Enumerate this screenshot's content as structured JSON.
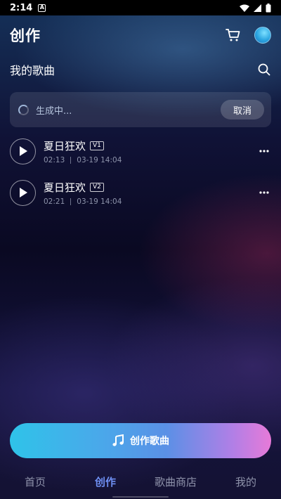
{
  "status_bar": {
    "time": "2:14",
    "notification_glyph": "A"
  },
  "header": {
    "title": "创作"
  },
  "section": {
    "label": "我的歌曲"
  },
  "generating": {
    "text": "生成中...",
    "cancel_label": "取消"
  },
  "songs": [
    {
      "title": "夏日狂欢",
      "version": "V1",
      "duration": "02:13",
      "date": "03-19 14:04"
    },
    {
      "title": "夏日狂欢",
      "version": "V2",
      "duration": "02:21",
      "date": "03-19 14:04"
    }
  ],
  "create_button": {
    "label": "创作歌曲"
  },
  "tabs": [
    {
      "label": "首页",
      "active": false
    },
    {
      "label": "创作",
      "active": true
    },
    {
      "label": "歌曲商店",
      "active": false
    },
    {
      "label": "我的",
      "active": false
    }
  ],
  "colors": {
    "accent": "#6e8ff2",
    "tab_inactive": "#8f93ab"
  }
}
